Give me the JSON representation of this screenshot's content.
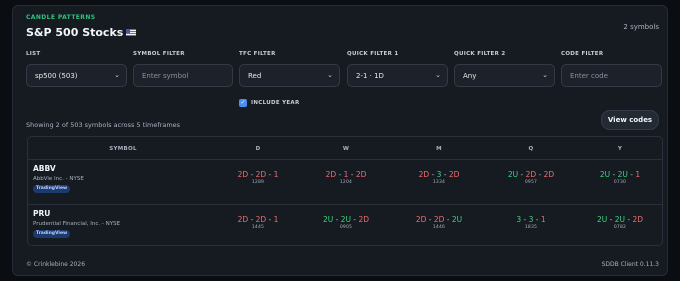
{
  "header": {
    "kicker": "CANDLE PATTERNS",
    "title": "S&P 500 Stocks",
    "flag_icon": "us-flag-icon",
    "symbol_count": "2 symbols"
  },
  "filters": {
    "list": {
      "label": "LIST",
      "value": "sp500 (503)"
    },
    "symbol": {
      "label": "SYMBOL FILTER",
      "placeholder": "Enter symbol"
    },
    "tfc": {
      "label": "TFC FILTER",
      "value": "Red"
    },
    "quick1": {
      "label": "QUICK FILTER 1",
      "value": "2-1 · 1D"
    },
    "quick2": {
      "label": "QUICK FILTER 2",
      "value": "Any"
    },
    "code": {
      "label": "CODE FILTER",
      "placeholder": "Enter code"
    },
    "include_year": {
      "label": "INCLUDE YEAR",
      "checked": true
    }
  },
  "summary": {
    "showing": "Showing 2 of 503 symbols across 5 timeframes",
    "view_codes": "View codes"
  },
  "table": {
    "headers": [
      "SYMBOL",
      "D",
      "W",
      "M",
      "Q",
      "Y"
    ],
    "rows": [
      {
        "ticker": "ABBV",
        "company": "AbbVie Inc. - NYSE",
        "badge": "TradingView",
        "cells": [
          {
            "parts": [
              "2D",
              "2D",
              "1"
            ],
            "code": "1289"
          },
          {
            "parts": [
              "2D",
              "1",
              "2D"
            ],
            "code": "1204"
          },
          {
            "parts": [
              "2D",
              "3",
              "2D"
            ],
            "code": "1334"
          },
          {
            "parts": [
              "2U",
              "2D",
              "2D"
            ],
            "code": "0957"
          },
          {
            "parts": [
              "2U",
              "2U",
              "1"
            ],
            "code": "0730"
          }
        ]
      },
      {
        "ticker": "PRU",
        "company": "Prudential Financial, Inc. - NYSE",
        "badge": "TradingView",
        "cells": [
          {
            "parts": [
              "2D",
              "2D",
              "1"
            ],
            "code": "1445"
          },
          {
            "parts": [
              "2U",
              "2U",
              "2D"
            ],
            "code": "0905"
          },
          {
            "parts": [
              "2D",
              "2D",
              "2U"
            ],
            "code": "1446"
          },
          {
            "parts": [
              "3",
              "3",
              "1"
            ],
            "code": "1835"
          },
          {
            "parts": [
              "2U",
              "2U",
              "2D"
            ],
            "code": "0782"
          }
        ]
      }
    ]
  },
  "footer": {
    "copyright": "© Crinklebine 2026",
    "version": "SDDB Client 0.11.3"
  },
  "colors": {
    "up": "#3fd483",
    "down": "#f06d6d",
    "accent": "#2ec27e",
    "checkbox": "#4b8df5"
  }
}
